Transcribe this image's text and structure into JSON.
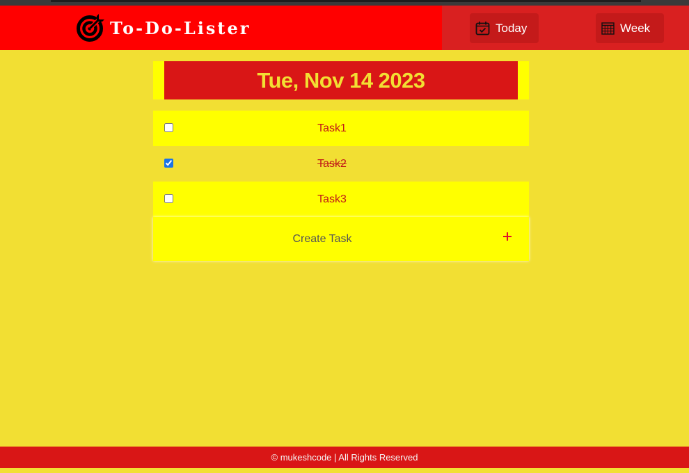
{
  "app": {
    "title": "To-Do-Lister",
    "logo_icon": "target-icon"
  },
  "nav": {
    "today": {
      "label": "Today",
      "icon": "calendar-check-icon"
    },
    "week": {
      "label": "Week",
      "icon": "calendar-grid-icon"
    }
  },
  "date_heading": "Tue, Nov 14 2023",
  "tasks": [
    {
      "label": "Task1",
      "done": false
    },
    {
      "label": "Task2",
      "done": true
    },
    {
      "label": "Task3",
      "done": false
    }
  ],
  "create": {
    "label": "Create Task",
    "icon": "plus-icon"
  },
  "footer": {
    "text": "© mukeshcode | All Rights Reserved"
  },
  "colors": {
    "header_red": "#ff0000",
    "dark_red": "#d91616",
    "background_yellow": "#f2df33",
    "bright_yellow": "#ffff00"
  }
}
